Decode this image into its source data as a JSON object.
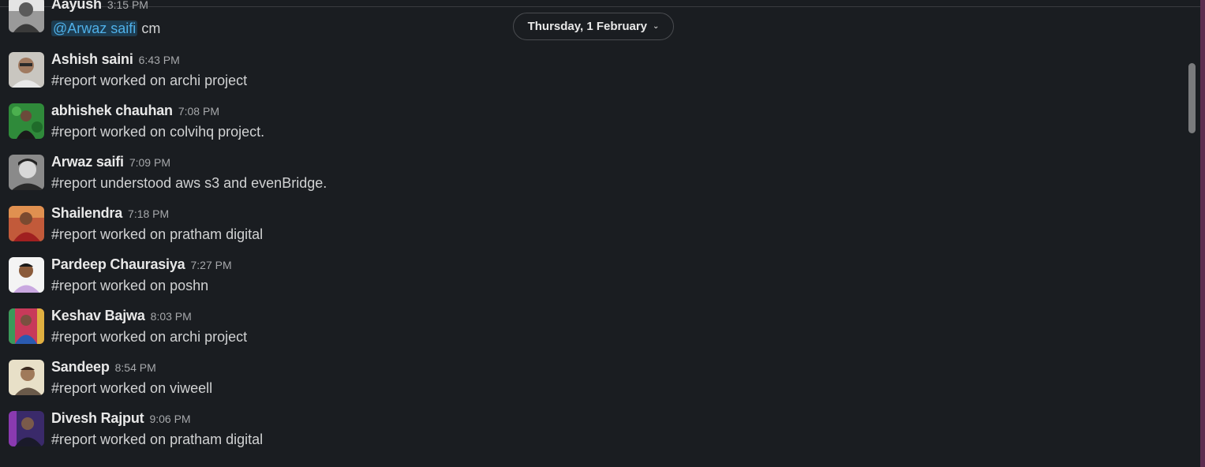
{
  "date_divider": {
    "label": "Thursday, 1 February"
  },
  "messages": [
    {
      "author": "Aayush",
      "time": "3:15 PM",
      "mention": "@Arwaz saifi",
      "text": "cm",
      "avatar_icon": "user-avatar-icon"
    },
    {
      "author": "Ashish saini",
      "time": "6:43 PM",
      "text": "#report worked on archi project",
      "avatar_icon": "user-avatar-icon"
    },
    {
      "author": "abhishek chauhan",
      "time": "7:08 PM",
      "text": "#report worked on colvihq project.",
      "avatar_icon": "user-avatar-icon"
    },
    {
      "author": "Arwaz saifi",
      "time": "7:09 PM",
      "text": "#report understood aws s3 and evenBridge.",
      "avatar_icon": "user-avatar-icon"
    },
    {
      "author": "Shailendra",
      "time": "7:18 PM",
      "text": "#report worked on pratham digital",
      "avatar_icon": "user-avatar-icon"
    },
    {
      "author": "Pardeep Chaurasiya",
      "time": "7:27 PM",
      "text": "#report worked on poshn",
      "avatar_icon": "user-avatar-icon"
    },
    {
      "author": "Keshav Bajwa",
      "time": "8:03 PM",
      "text": "#report worked on archi project",
      "avatar_icon": "user-avatar-icon"
    },
    {
      "author": "Sandeep",
      "time": "8:54 PM",
      "text": "#report worked on viweell",
      "avatar_icon": "user-avatar-icon"
    },
    {
      "author": "Divesh Rajput",
      "time": "9:06 PM",
      "text": "#report worked on pratham digital",
      "avatar_icon": "user-avatar-icon"
    }
  ],
  "colors": {
    "background": "#1a1d21",
    "text": "#d1d2d3",
    "mention_text": "#4fb0e8",
    "mention_bg": "#1d3b4f",
    "timestamp": "#a6a8ab"
  }
}
